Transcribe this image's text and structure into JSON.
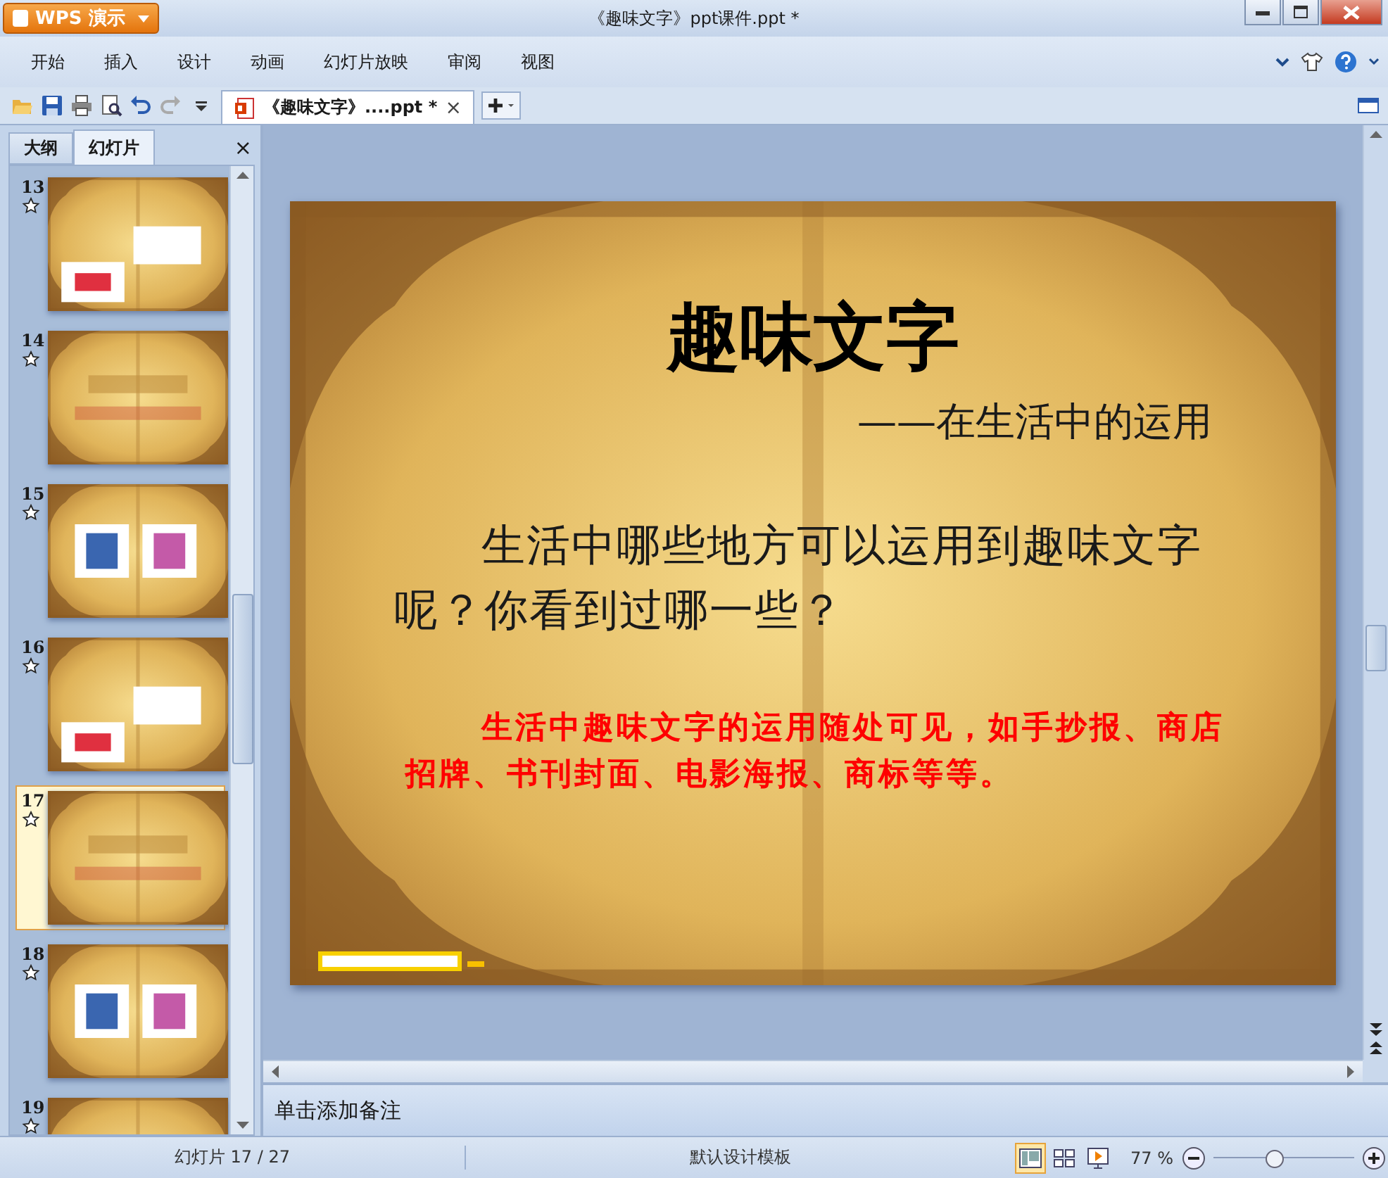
{
  "app_button": {
    "label": "WPS 演示"
  },
  "window": {
    "title": "《趣味文字》ppt课件.ppt *"
  },
  "menu": [
    "开始",
    "插入",
    "设计",
    "动画",
    "幻灯片放映",
    "审阅",
    "视图"
  ],
  "document_tab": {
    "label": "《趣味文字》....ppt *",
    "close": "×",
    "selected": true
  },
  "side_panel": {
    "tabs": [
      {
        "label": "大纲",
        "selected": false
      },
      {
        "label": "幻灯片",
        "selected": true
      }
    ],
    "close": "×",
    "thumbnails": [
      {
        "number": "13",
        "selected": false
      },
      {
        "number": "14",
        "selected": false
      },
      {
        "number": "15",
        "selected": false
      },
      {
        "number": "16",
        "selected": false
      },
      {
        "number": "17",
        "selected": true
      },
      {
        "number": "18",
        "selected": false
      },
      {
        "number": "19",
        "selected": false
      }
    ]
  },
  "slide": {
    "title": "趣味文字",
    "subtitle": "——在生活中的运用",
    "question": "生活中哪些地方可以运用到趣味文字呢？你看到过哪一些？",
    "answer": "生活中趣味文字的运用随处可见，如手抄报、商店招牌、书刊封面、电影海报、商标等等。"
  },
  "notes": {
    "placeholder": "单击添加备注"
  },
  "status_bar": {
    "slide_counter": "幻灯片 17 / 27",
    "template": "默认设计模板",
    "views": [
      {
        "kind": "normal",
        "selected": true
      },
      {
        "kind": "sorter",
        "selected": false
      },
      {
        "kind": "show",
        "selected": false
      }
    ],
    "zoom": "77 %",
    "zoom_slider": {
      "level": 0.43
    }
  }
}
